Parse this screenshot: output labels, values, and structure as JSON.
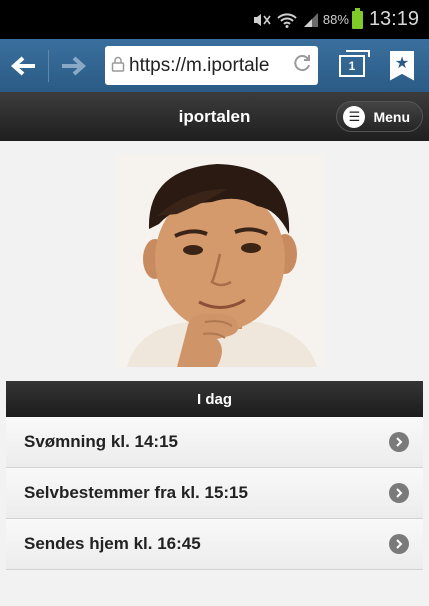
{
  "status_bar": {
    "battery_percent": "88%",
    "time": "13:19",
    "icons": [
      "mute-icon",
      "wifi-icon",
      "signal-icon",
      "battery-icon"
    ]
  },
  "browser": {
    "url": "https://m.iportale",
    "accent_color": "#2b5b86",
    "tabs_count": "1"
  },
  "header": {
    "title": "iportalen",
    "menu_label": "Menu"
  },
  "section": {
    "title": "I dag"
  },
  "items": [
    {
      "label": "Svømning kl. 14:15"
    },
    {
      "label": "Selvbestemmer fra kl. 15:15"
    },
    {
      "label": "Sendes hjem kl. 16:45"
    }
  ]
}
